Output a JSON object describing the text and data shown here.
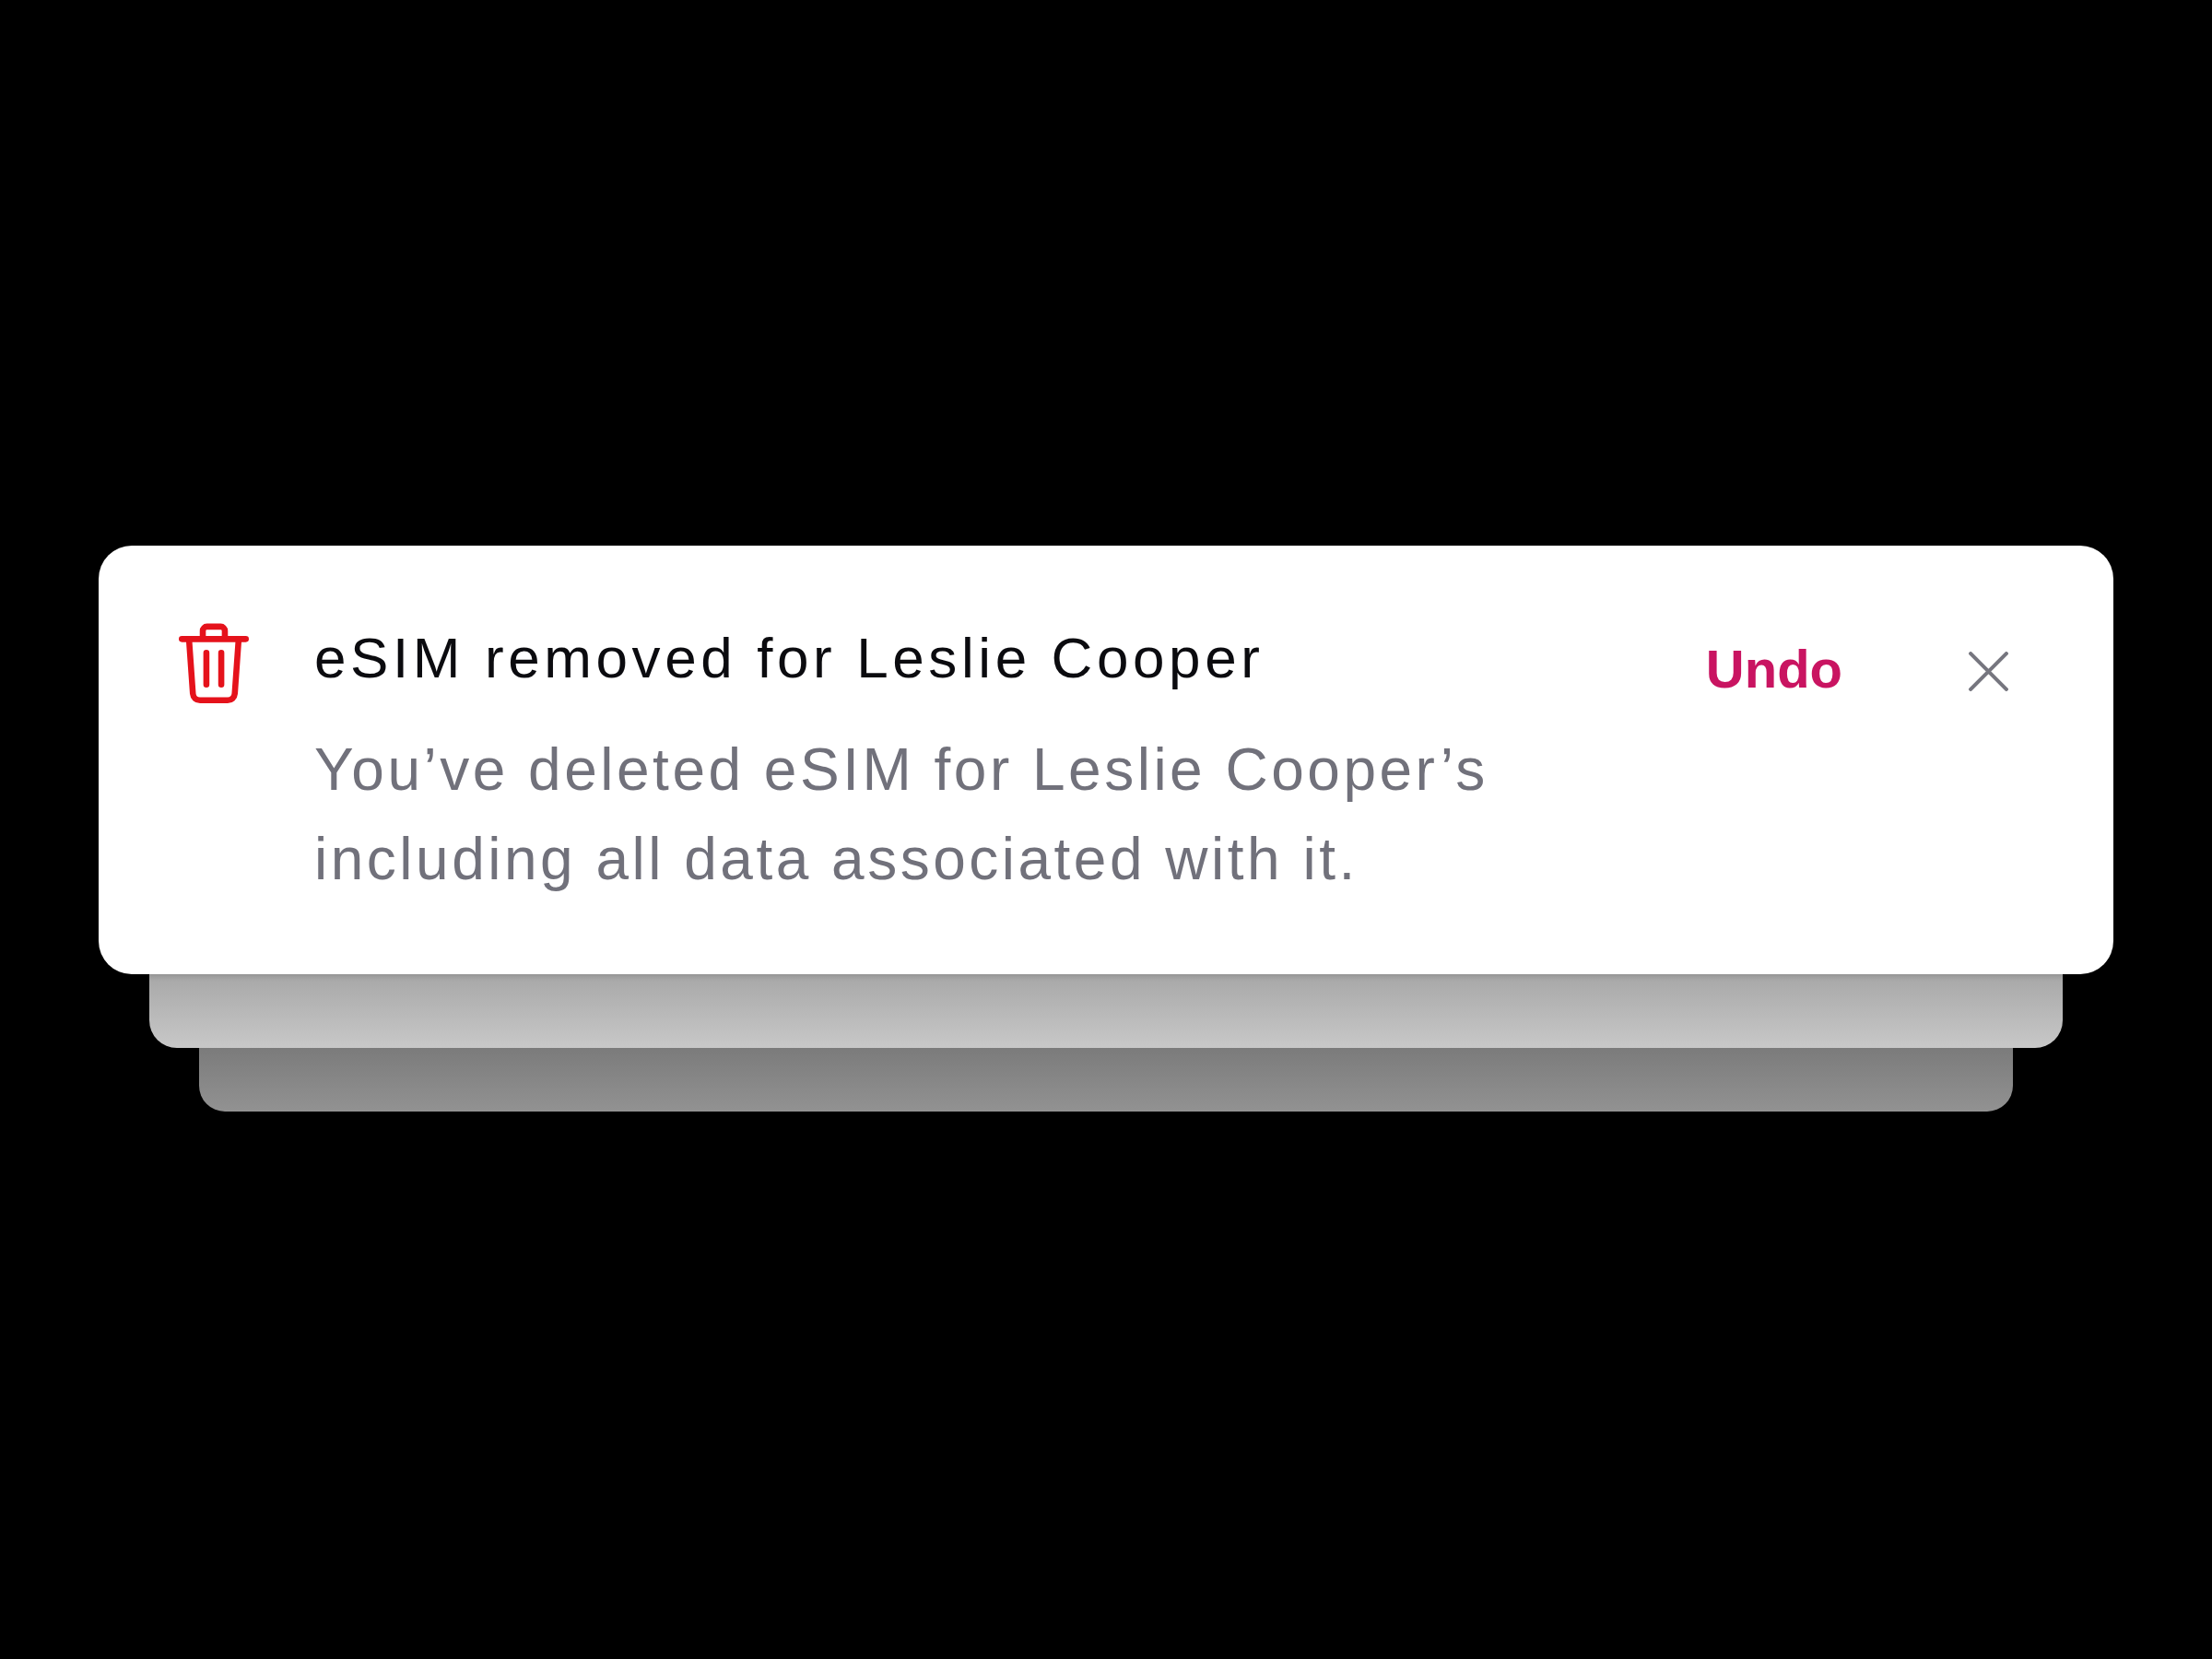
{
  "toast": {
    "title": "eSIM removed for Leslie Cooper",
    "message": "You’ve deleted eSIM for Leslie Cooper’s including all data associated with it.",
    "action": "Undo"
  }
}
